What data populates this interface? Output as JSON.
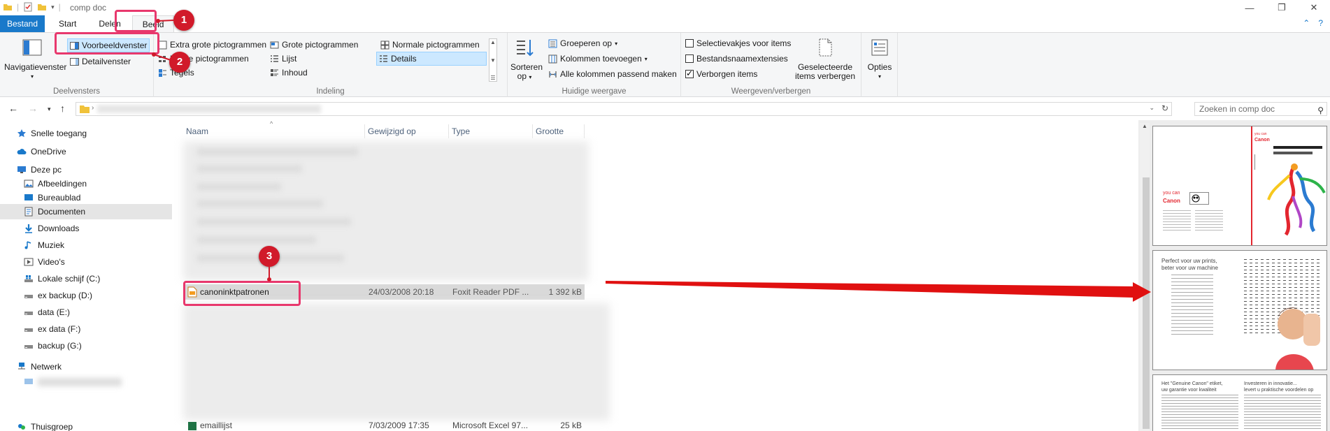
{
  "window": {
    "title": "comp doc",
    "buttons": {
      "minimize": "—",
      "maximize": "❐",
      "close": "✕"
    }
  },
  "ribbon_tabs": [
    {
      "label": "Bestand"
    },
    {
      "label": "Start"
    },
    {
      "label": "Delen"
    },
    {
      "label": "Beeld"
    }
  ],
  "ribbon": {
    "panes": {
      "nav_pane": "Navigatievenster",
      "preview_pane": "Voorbeeldvenster",
      "details_pane": "Detailvenster",
      "group_label": "Deelvensters"
    },
    "layout": {
      "extra_large": "Extra grote pictogrammen",
      "large": "Grote pictogrammen",
      "normal": "Normale pictogrammen",
      "small": "Kleine pictogrammen",
      "list": "Lijst",
      "details": "Details",
      "tiles": "Tegels",
      "content": "Inhoud",
      "group_label": "Indeling"
    },
    "current_view": {
      "sort_by_line1": "Sorteren",
      "sort_by_line2": "op",
      "group_by": "Groeperen op",
      "add_columns": "Kolommen toevoegen",
      "size_columns": "Alle kolommen passend maken",
      "group_label": "Huidige weergave"
    },
    "show_hide": {
      "item_checkboxes": "Selectievakjes voor items",
      "file_extensions": "Bestandsnaamextensies",
      "hidden_items": "Verborgen items",
      "hide_selected_line1": "Geselecteerde",
      "hide_selected_line2": "items verbergen",
      "group_label": "Weergeven/verbergen"
    },
    "options": "Opties"
  },
  "search": {
    "placeholder": "Zoeken in comp doc"
  },
  "nav_items": [
    {
      "label": "Snelle toegang"
    },
    {
      "label": "OneDrive"
    },
    {
      "label": "Deze pc"
    },
    {
      "label": "Afbeeldingen"
    },
    {
      "label": "Bureaublad"
    },
    {
      "label": "Documenten"
    },
    {
      "label": "Downloads"
    },
    {
      "label": "Muziek"
    },
    {
      "label": "Video's"
    },
    {
      "label": "Lokale schijf (C:)"
    },
    {
      "label": "ex backup (D:)"
    },
    {
      "label": "data (E:)"
    },
    {
      "label": "ex data (F:)"
    },
    {
      "label": "backup (G:)"
    },
    {
      "label": "Netwerk"
    },
    {
      "label": "Thuisgroep"
    }
  ],
  "columns": {
    "name": "Naam",
    "modified": "Gewijzigd op",
    "type": "Type",
    "size": "Grootte"
  },
  "files": {
    "selected": {
      "name": "canoninktpatronen",
      "modified": "24/03/2008 20:18",
      "type": "Foxit Reader PDF ...",
      "size": "1 392 kB"
    },
    "last": {
      "name": "emaillijst",
      "modified": "7/03/2009 17:35",
      "type": "Microsoft Excel 97...",
      "size": "25 kB"
    }
  },
  "preview": {
    "page1": {
      "brand": "Canon",
      "tagline": "you can"
    },
    "page2": {
      "heading_line1": "Perfect voor uw prints,",
      "heading_line2": "beter voor uw machine"
    },
    "page3": {
      "left_heading_line1": "Het \"Genuine Canon\" etiket,",
      "left_heading_line2": "uw garantie voor kwaliteit",
      "right_heading_line1": "Investeren in innovatie...",
      "right_heading_line2": "levert u praktische voordelen op"
    }
  },
  "annotations": [
    "1",
    "2",
    "3"
  ],
  "colors": {
    "accent": "#1979ca",
    "highlight": "#e8386d",
    "badge": "#d11a2a",
    "arrow": "#e01010"
  }
}
